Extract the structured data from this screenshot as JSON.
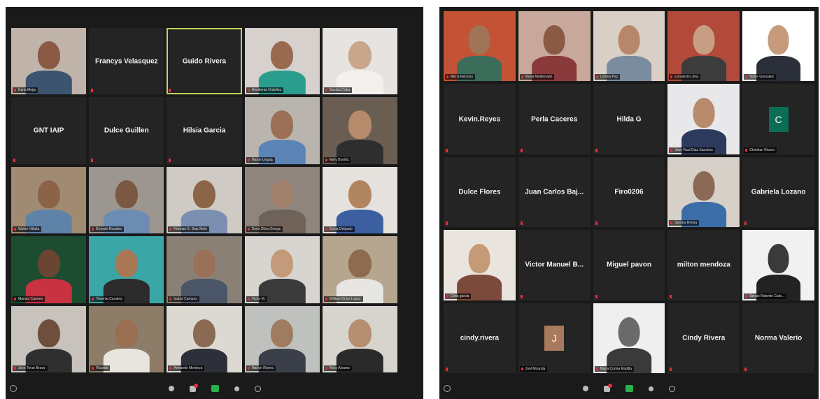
{
  "left_window": {
    "tiles": [
      {
        "type": "video",
        "label": "Karla Mejia",
        "bg": "#bfb3aa",
        "skin": "#8a5a45",
        "shirt": "#3c5470"
      },
      {
        "type": "name",
        "name": "Francys Velasquez"
      },
      {
        "type": "name",
        "name": "Guido Rivera",
        "active": true
      },
      {
        "type": "video",
        "label": "Hemilenia Ordoñez",
        "bg": "#d6d1cd",
        "skin": "#9a6a50",
        "shirt": "#2a9d8f"
      },
      {
        "type": "video",
        "label": "Sandra Cobo",
        "bg": "#e7e3e0",
        "skin": "#c9a58a",
        "shirt": "#f3f0ee"
      },
      {
        "type": "name",
        "name": "GNT IAIP"
      },
      {
        "type": "name",
        "name": "Dulce Guillen"
      },
      {
        "type": "name",
        "name": "Hilsia Garcia"
      },
      {
        "type": "video",
        "label": "Martin Urquia",
        "bg": "#b9b4ae",
        "skin": "#9c7057",
        "shirt": "#5d84b6"
      },
      {
        "type": "video",
        "label": "Nelly Bonilla",
        "bg": "#6a5d52",
        "skin": "#b58b6c",
        "shirt": "#2e2e2e"
      },
      {
        "type": "video",
        "label": "Walter Villalta",
        "bg": "#a08a72",
        "skin": "#8b6448",
        "shirt": "#5f82a8"
      },
      {
        "type": "video",
        "label": "Ernesto Rosales",
        "bg": "#9c9690",
        "skin": "#7c5741",
        "shirt": "#6d8cb4"
      },
      {
        "type": "video",
        "label": "Herman E. Diaz Melo",
        "bg": "#cfcac4",
        "skin": "#8c6448",
        "shirt": "#7a8fb2"
      },
      {
        "type": "video",
        "label": "Doris Oliva Ortega",
        "bg": "#8f857c",
        "skin": "#a0806a",
        "shirt": "#6f6259"
      },
      {
        "type": "video",
        "label": "Sonia Delgado",
        "bg": "#e5e1dc",
        "skin": "#b08560",
        "shirt": "#3b5fa0"
      },
      {
        "type": "video",
        "label": "Marisol Carmen",
        "bg": "#1d4d30",
        "skin": "#6a4532",
        "shirt": "#c93241"
      },
      {
        "type": "video",
        "label": "Yesenia Canales",
        "bg": "#3aa7a6",
        "skin": "#a87855",
        "shirt": "#2b2b2b"
      },
      {
        "type": "video",
        "label": "Isabel Campos",
        "bg": "#8b8075",
        "skin": "#9a7059",
        "shirt": "#4a5568"
      },
      {
        "type": "video",
        "label": "Victor M.",
        "bg": "#d8d4cf",
        "skin": "#c39a7a",
        "shirt": "#3a3a3a"
      },
      {
        "type": "video",
        "label": "William Ortez Lopez",
        "bg": "#b6a690",
        "skin": "#8e6a4e",
        "shirt": "#e8e6e2"
      },
      {
        "type": "video",
        "label": "Jose Tovar Bravo",
        "bg": "#c7c2bc",
        "skin": "#6e4f3c",
        "shirt": "#2f2f2f"
      },
      {
        "type": "video",
        "label": "Ricardo",
        "bg": "#8d7c68",
        "skin": "#9a6e50",
        "shirt": "#e8e4de"
      },
      {
        "type": "video",
        "label": "Armando Montoya",
        "bg": "#dcd8d2",
        "skin": "#8a6a52",
        "shirt": "#2d3038"
      },
      {
        "type": "video",
        "label": "Marlon Rivera",
        "bg": "#bfc1bf",
        "skin": "#9f7b60",
        "shirt": "#3a3f4a"
      },
      {
        "type": "video",
        "label": "Roxy Alvarez",
        "bg": "#d7d3cd",
        "skin": "#b58e70",
        "shirt": "#2a2a2a"
      }
    ]
  },
  "right_window": {
    "tiles": [
      {
        "type": "video",
        "label": "Mirna Recinos",
        "bg": "#c45234",
        "skin": "#a07458",
        "shirt": "#3c6c5a"
      },
      {
        "type": "video",
        "label": "Maria Maldonado",
        "bg": "#c8a89a",
        "skin": "#8a5a43",
        "shirt": "#8a3a3a"
      },
      {
        "type": "video",
        "label": "Lorena Paz",
        "bg": "#d9cfc6",
        "skin": "#b8876a",
        "shirt": "#7b8c9e"
      },
      {
        "type": "video",
        "label": "Leonardo Lima",
        "bg": "#b14a3b",
        "skin": "#c79e84",
        "shirt": "#3c3c3c"
      },
      {
        "type": "video",
        "label": "Victor Gonzalez",
        "bg": "#ffffff",
        "skin": "#c79a7c",
        "shirt": "#2b2f3a"
      },
      {
        "type": "name",
        "name": "Kevin.Reyes"
      },
      {
        "type": "name",
        "name": "Perla Caceres"
      },
      {
        "type": "name",
        "name": "Hilda G"
      },
      {
        "type": "video",
        "label": "Jose Raul Diaz Sanchez",
        "bg": "#e8e8ea",
        "skin": "#b78b6c",
        "shirt": "#2d3a5c"
      },
      {
        "type": "avatar",
        "letter": "C",
        "label": "Christian Rivera",
        "avatar_bg": "#0a6d55"
      },
      {
        "type": "name",
        "name": "Dulce Flores"
      },
      {
        "type": "name",
        "name": "Juan Carlos Baj..."
      },
      {
        "type": "name",
        "name": "Firo0206"
      },
      {
        "type": "video",
        "label": "Sandra Rivera",
        "bg": "#d6d0c8",
        "skin": "#8a6a54",
        "shirt": "#3b6ea8"
      },
      {
        "type": "name",
        "name": "Gabriela Lozano"
      },
      {
        "type": "video",
        "label": "Celia garcia",
        "bg": "#e9e4dd",
        "skin": "#c59a77",
        "shirt": "#7c4a3a"
      },
      {
        "type": "name",
        "name": "Victor Manuel B..."
      },
      {
        "type": "name",
        "name": "Miguel pavon"
      },
      {
        "type": "name",
        "name": "milton mendoza"
      },
      {
        "type": "video",
        "label": "Sergio Roberto Carb...",
        "bg": "#f1f1f1",
        "skin": "#3a3a3a",
        "shirt": "#222222"
      },
      {
        "type": "name",
        "name": "cindy.rivera"
      },
      {
        "type": "avatar",
        "letter": "J",
        "label": "Joel Miranda",
        "avatar_bg": "#a97a5d"
      },
      {
        "type": "video",
        "label": "Maria Corina Radilla",
        "bg": "#efefef",
        "skin": "#6a6a6a",
        "shirt": "#3a3a3a"
      },
      {
        "type": "name",
        "name": "Cindy Rivera"
      },
      {
        "type": "name",
        "name": "Norma Valerio"
      }
    ]
  },
  "toolbar": {
    "icons": [
      "mic-icon",
      "participants-icon",
      "chat-icon",
      "share-screen-icon",
      "record-icon",
      "reactions-icon"
    ],
    "chat_badge_color": "#e0313a",
    "share_color": "#28b24b"
  }
}
